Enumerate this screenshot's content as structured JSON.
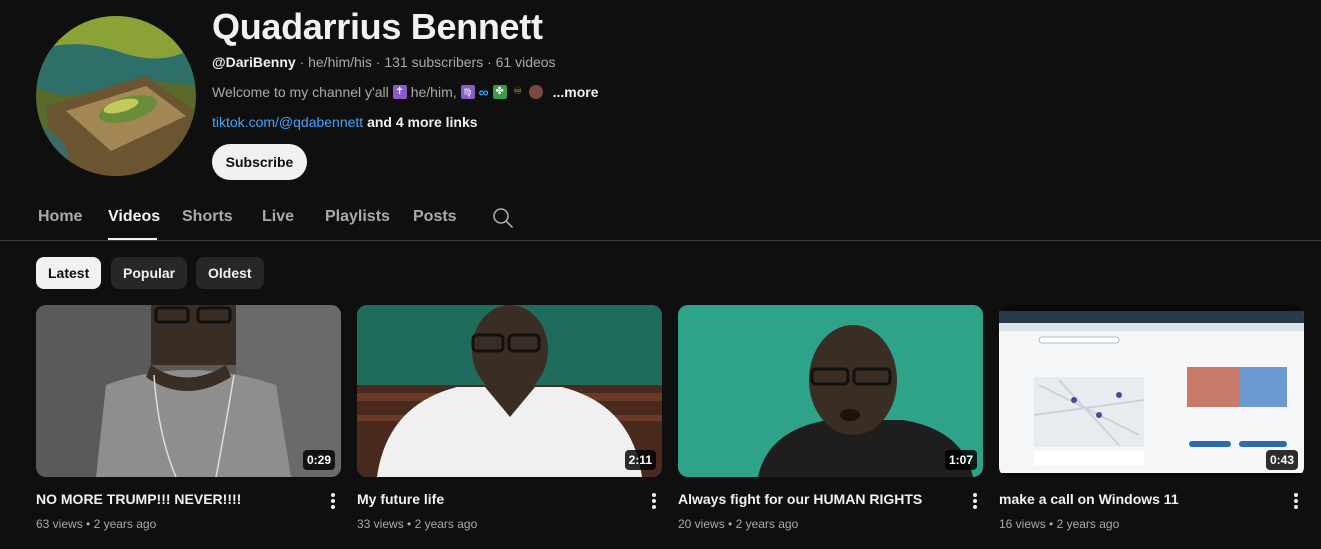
{
  "channel": {
    "name": "Quadarrius Bennett",
    "handle": "@DariBenny",
    "meta_rest": " · he/him/his · 131 subscribers · 61 videos",
    "description": "Welcome to my channel y'all",
    "description_pronouns": "he/him,",
    "more_label": "...more",
    "link_text": "tiktok.com/@qdabennett",
    "extra_links": "and 4 more links",
    "subscribe_label": "Subscribe"
  },
  "tabs": [
    {
      "label": "Home"
    },
    {
      "label": "Videos"
    },
    {
      "label": "Shorts"
    },
    {
      "label": "Live"
    },
    {
      "label": "Playlists"
    },
    {
      "label": "Posts"
    }
  ],
  "active_tab": "Videos",
  "chips": [
    {
      "label": "Latest"
    },
    {
      "label": "Popular"
    },
    {
      "label": "Oldest"
    }
  ],
  "selected_chip": "Latest",
  "videos": [
    {
      "title": "NO MORE TRUMP!!! NEVER!!!!",
      "duration": "0:29",
      "views": "63 views",
      "age": "2 years ago"
    },
    {
      "title": "My future life",
      "duration": "2:11",
      "views": "33 views",
      "age": "2 years ago"
    },
    {
      "title": "Always fight for our HUMAN RIGHTS",
      "duration": "1:07",
      "views": "20 views",
      "age": "2 years ago"
    },
    {
      "title": "make a call on Windows 11",
      "duration": "0:43",
      "views": "16 views",
      "age": "2 years ago"
    }
  ],
  "colors": {
    "background": "#0f0f0f",
    "text_primary": "#f1f1f1",
    "text_secondary": "#aaaaaa",
    "link": "#3ea6ff",
    "chip": "#272727"
  },
  "icons": [
    "search-icon",
    "more-vert-icon"
  ]
}
